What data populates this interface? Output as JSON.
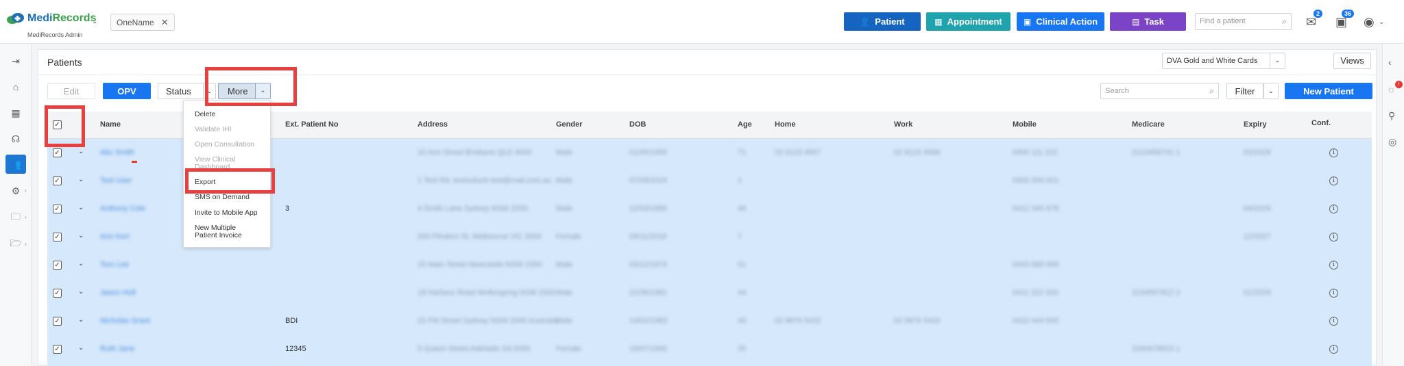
{
  "app": {
    "name_part1": "Medi",
    "name_part2": "Records",
    "subtitle": "MediRecords Admin",
    "tenant_chip": "OneName"
  },
  "toolbar_top": {
    "patient": "Patient",
    "appointment": "Appointment",
    "clinical_action": "Clinical Action",
    "task": "Task",
    "find_placeholder": "Find a patient",
    "mail_count": "2",
    "tasks_count": "36"
  },
  "page": {
    "title": "Patients",
    "view_selected": "DVA Gold and White Cards",
    "views_label": "Views"
  },
  "actions": {
    "edit": "Edit",
    "opv": "OPV",
    "status": "Status",
    "more": "More",
    "search_placeholder": "Search",
    "filter": "Filter",
    "new_patient": "New Patient"
  },
  "columns": {
    "name": "Name",
    "ext_patient_no": "Ext. Patient No",
    "address": "Address",
    "gender": "Gender",
    "dob": "DOB",
    "age": "Age",
    "home": "Home",
    "work": "Work",
    "mobile": "Mobile",
    "medicare": "Medicare",
    "expiry": "Expiry",
    "conf": "Conf."
  },
  "more_menu": {
    "delete": "Delete",
    "validate_ihi": "Validate IHI",
    "open_consultation": "Open Consultation",
    "view_clinical_line1": "View Clinical",
    "view_clinical_line2": "Dashboard",
    "export": "Export",
    "sms_on_demand": "SMS on Demand",
    "invite_mobile": "Invite to Mobile App",
    "new_invoice_line1": "New Multiple",
    "new_invoice_line2": "Patient Invoice"
  },
  "rows": [
    {
      "name": "Abc Smith",
      "ext": "",
      "address": "10 Ann Street Brisbane QLD 4000",
      "gender": "Male",
      "dob": "01/05/1955",
      "age": "71",
      "home": "02 9123 4567",
      "work": "02 9123 4568",
      "mobile": "0400 111 222",
      "medicare": "2123456701 1",
      "expiry": "03/2028"
    },
    {
      "name": "Test User",
      "ext": "",
      "address": "1 Test Rd, testsuburb test@mail.com.au",
      "gender": "Male",
      "dob": "07/08/2024",
      "age": "1",
      "home": "",
      "work": "",
      "mobile": "0400 000 001",
      "medicare": "",
      "expiry": ""
    },
    {
      "name": "Anthony Cole",
      "ext": "3",
      "address": "4 Smith Lane Sydney NSW 2000",
      "gender": "Male",
      "dob": "12/03/1980",
      "age": "46",
      "home": "",
      "work": "",
      "mobile": "0412 345 678",
      "medicare": "",
      "expiry": "04/2026"
    },
    {
      "name": "Ann Kerr",
      "ext": "",
      "address": "200 Flinders St, Melbourne VIC 3000",
      "gender": "Female",
      "dob": "09/11/2018",
      "age": "7",
      "home": "",
      "work": "",
      "mobile": "",
      "medicare": "",
      "expiry": "12/2027"
    },
    {
      "name": "Tom Lee",
      "ext": "",
      "address": "15 Main Street Newcastle NSW 2300",
      "gender": "Male",
      "dob": "03/12/1974",
      "age": "51",
      "home": "",
      "work": "",
      "mobile": "0433 888 999",
      "medicare": "",
      "expiry": ""
    },
    {
      "name": "Jason Holt",
      "ext": "",
      "address": "18 Harbour Road Wollongong NSW 2500",
      "gender": "Male",
      "dob": "21/06/1981",
      "age": "44",
      "home": "",
      "work": "",
      "mobile": "0411 222 333",
      "medicare": "2234567812 2",
      "expiry": "01/2029"
    },
    {
      "name": "Nicholas Grant",
      "ext": "BDI",
      "address": "22 Pitt Street Sydney NSW 2000 Australia",
      "gender": "Male",
      "dob": "14/02/1983",
      "age": "43",
      "home": "02 9876 5432",
      "work": "02 9876 5433",
      "mobile": "0422 444 555",
      "medicare": "",
      "expiry": ""
    },
    {
      "name": "Ruth Jane",
      "ext": "12345",
      "address": "5 Queen Street Adelaide SA 5000",
      "gender": "Female",
      "dob": "19/07/1990",
      "age": "35",
      "home": "",
      "work": "",
      "mobile": "",
      "medicare": "3345678923 1",
      "expiry": ""
    }
  ]
}
